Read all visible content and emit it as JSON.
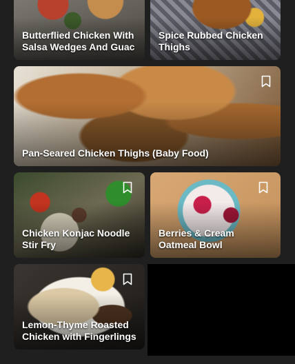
{
  "recipes": [
    {
      "title": "Butterflied Chicken With Salsa Wedges And Guac"
    },
    {
      "title": "Spice Rubbed Chicken Thighs"
    },
    {
      "title": "Pan-Seared Chicken Thighs (Baby Food)"
    },
    {
      "title": "Chicken Konjac Noodle Stir Fry"
    },
    {
      "title": "Berries & Cream Oatmeal Bowl"
    },
    {
      "title": "Lemon-Thyme Roasted Chicken with Fingerlings"
    }
  ],
  "icons": {
    "bookmark": "bookmark-outline-icon"
  },
  "colors": {
    "background": "#1f1f1f",
    "title_text": "#ffffff"
  }
}
